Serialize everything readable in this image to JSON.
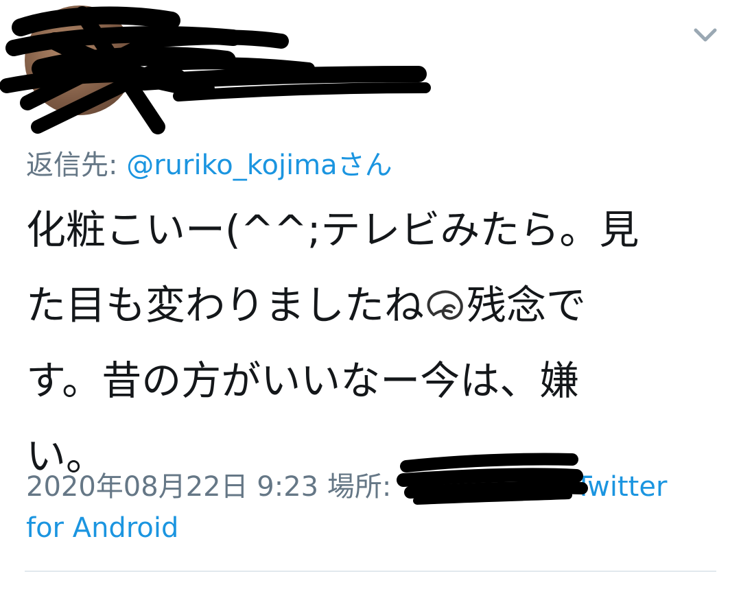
{
  "tweet": {
    "reply_label": "返信先: ",
    "reply_mention": "@ruriko_kojima",
    "reply_suffix": "さん",
    "text_lines": [
      "化粧こいー(^^;テレビみたら。見",
      "た目も変わりましたね",
      "残念で",
      "す。昔の方がいいなー今は、嫌",
      "い。"
    ],
    "date_label": "2020年08月22日 9:23 場所:",
    "source_label": "Twitter",
    "source_label_line2": "for Android"
  },
  "colors": {
    "link": "#1b95e0",
    "muted": "#657786",
    "text": "#14171a",
    "divider": "#e1e8ed"
  },
  "icons": {
    "menu": "chevron-down-icon",
    "emoji": "sweat-drop-icon"
  }
}
